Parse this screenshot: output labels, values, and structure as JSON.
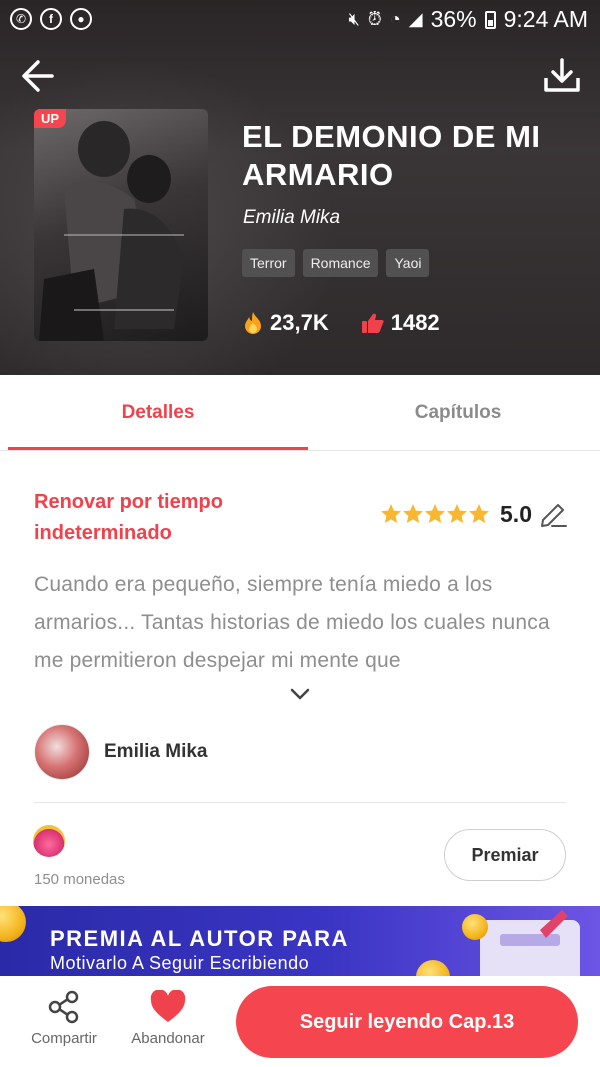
{
  "status_bar": {
    "battery": "36%",
    "time": "9:24 AM"
  },
  "book": {
    "badge": "UP",
    "title": "EL DEMONIO DE MI ARMARIO",
    "author": "Emilia Mika",
    "tags": [
      "Terror",
      "Romance",
      "Yaoi"
    ],
    "views": "23,7K",
    "likes": "1482"
  },
  "tabs": {
    "details": "Detalles",
    "chapters": "Capítulos"
  },
  "details": {
    "renewal": "Renovar por tiempo indeterminado",
    "rating": "5.0",
    "stars": 5,
    "description": "Cuando era pequeño, siempre tenía miedo a los armarios... Tantas historias de miedo los cuales nunca me permitieron despejar mi mente que",
    "author_name": "Emilia Mika",
    "coins": "150 monedas",
    "reward_button": "Premiar"
  },
  "banner": {
    "title": "PREMIA AL AUTOR PARA",
    "subtitle": "Motivarlo A Seguir Escribiendo"
  },
  "bottom_bar": {
    "share": "Compartir",
    "abandon": "Abandonar",
    "continue": "Seguir leyendo Cap.13"
  },
  "colors": {
    "accent": "#f54650",
    "star": "#f7b731"
  }
}
